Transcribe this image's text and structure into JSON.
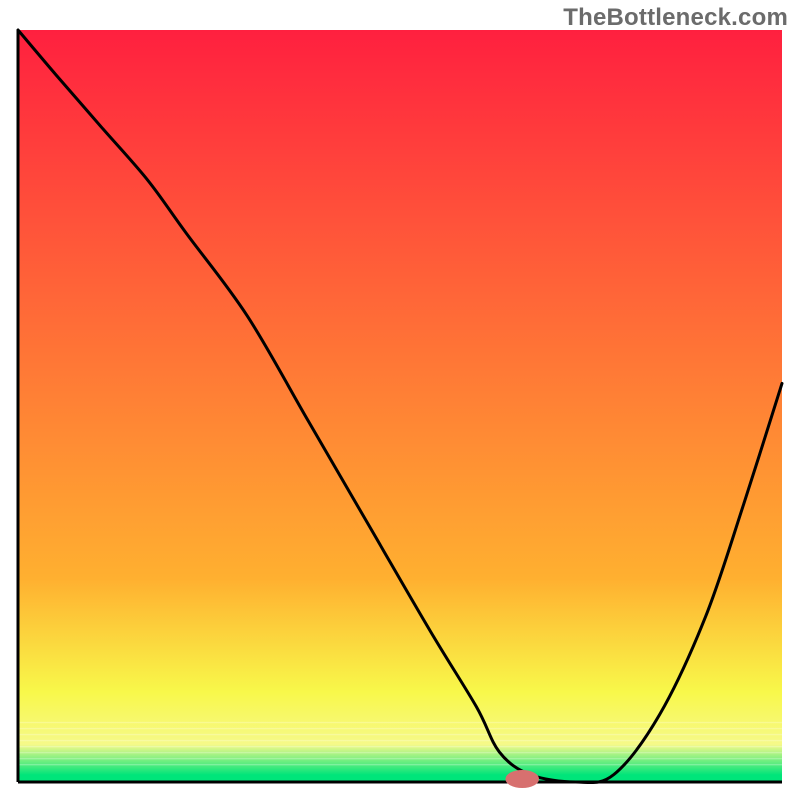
{
  "watermark": "TheBottleneck.com",
  "colors": {
    "red": "#ff203f",
    "orange": "#ffb030",
    "yellow": "#f8f84a",
    "paleYellow": "#f6f989",
    "green": "#00e57a",
    "stroke": "#000000",
    "marker": "#d7706f",
    "white": "#ffffff"
  },
  "chart_data": {
    "type": "line",
    "title": "",
    "xlabel": "",
    "ylabel": "",
    "xlim": [
      0,
      100
    ],
    "ylim": [
      0,
      100
    ],
    "x": [
      0,
      5,
      11,
      17,
      22,
      30,
      38,
      46,
      54,
      60,
      63,
      67,
      73,
      78,
      84,
      90,
      95,
      100
    ],
    "values": [
      100,
      94,
      87,
      80,
      73,
      62,
      48,
      34,
      20,
      10,
      4,
      1,
      0,
      1,
      9,
      22,
      37,
      53
    ],
    "marker": {
      "x": 66,
      "y": 0,
      "rx": 2.2,
      "ry": 1.2
    },
    "bands": [
      {
        "y0": 0,
        "y1": 73,
        "c0": "red",
        "c1": "orange"
      },
      {
        "y0": 73,
        "y1": 88,
        "c0": "orange",
        "c1": "yellow"
      },
      {
        "y0": 88,
        "y1": 95,
        "c0": "yellow",
        "c1": "paleYellow"
      },
      {
        "y0": 95,
        "y1": 99,
        "c0": "paleYellow",
        "c1": "green"
      },
      {
        "y0": 99,
        "y1": 100,
        "c0": "green",
        "c1": "green"
      }
    ]
  }
}
